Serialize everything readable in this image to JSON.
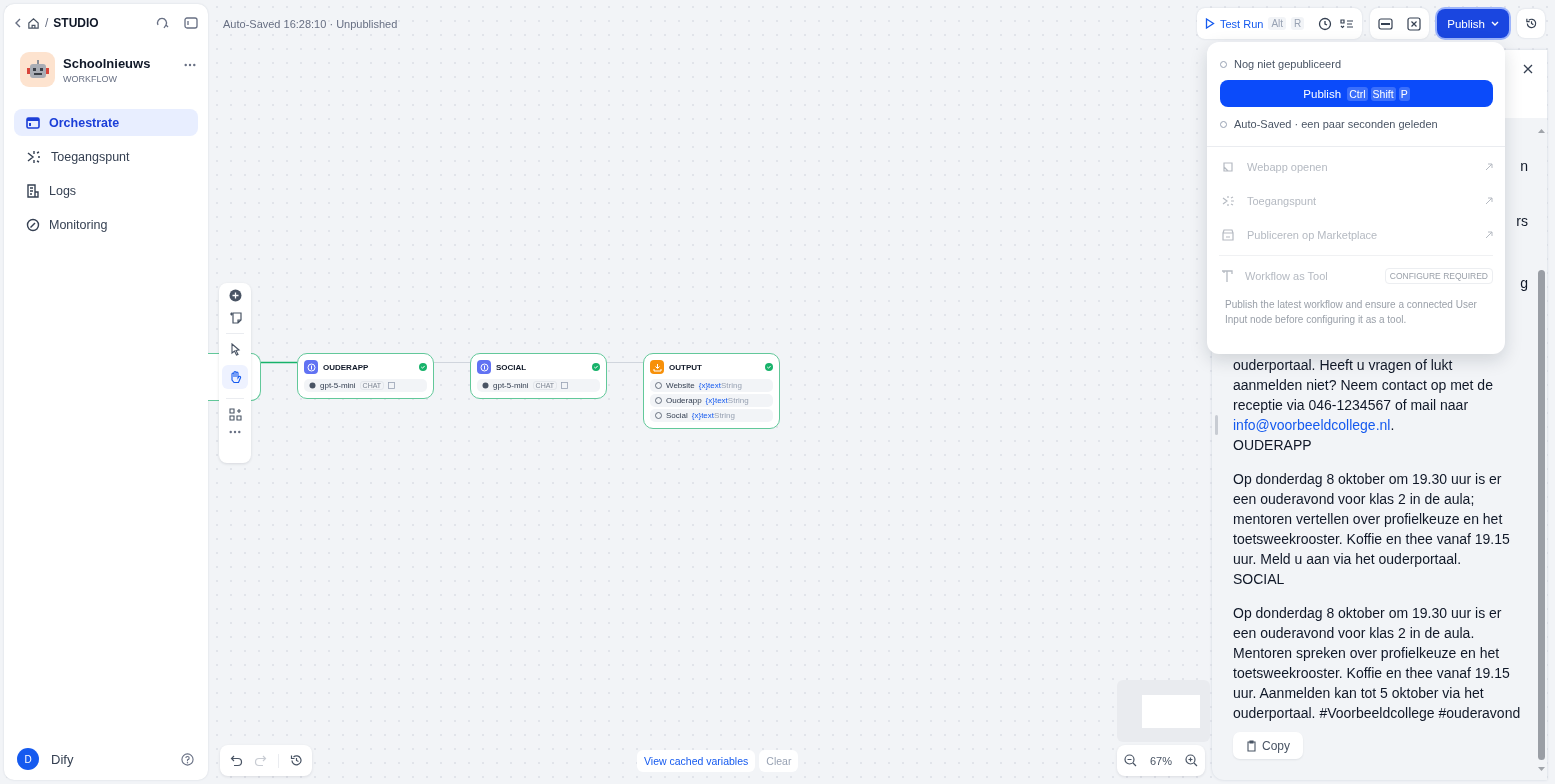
{
  "sidebar": {
    "separator": "/",
    "section": "STUDIO",
    "app": {
      "name": "Schoolnieuws",
      "type": "WORKFLOW"
    },
    "nav": [
      {
        "label": "Orchestrate",
        "selected": true
      },
      {
        "label": "Toegangspunt",
        "selected": false
      },
      {
        "label": "Logs",
        "selected": false
      },
      {
        "label": "Monitoring",
        "selected": false
      }
    ],
    "user": {
      "initial": "D",
      "name": "Dify"
    }
  },
  "header": {
    "status": "Auto-Saved 16:28:10 · Unpublished"
  },
  "toolbar": {
    "test_run": {
      "label": "Test Run",
      "keys": [
        "Alt",
        "R"
      ]
    },
    "publish": {
      "label": "Publish",
      "expanded": true
    }
  },
  "publish_menu": {
    "top_state": "Nog niet gepubliceerd",
    "publish_button": {
      "label": "Publish",
      "keys": [
        "Ctrl",
        "Shift",
        "P"
      ]
    },
    "bottom_state": "Auto-Saved · een paar seconden geleden",
    "actions": [
      {
        "label": "Webapp openen",
        "disabled": true
      },
      {
        "label": "Toegangspunt",
        "disabled": true
      },
      {
        "label": "Publiceren op Marketplace",
        "disabled": true
      }
    ],
    "tool": {
      "label": "Workflow as Tool",
      "badge": "CONFIGURE REQUIRED",
      "disabled": true
    },
    "hint": "Publish the latest workflow and ensure a connected User Input node before configuring it as a tool."
  },
  "canvas": {
    "nodes": [
      {
        "kind": "llm",
        "title": "OUDERAPP",
        "model": "gpt-5-mini",
        "mode": "CHAT"
      },
      {
        "kind": "llm",
        "title": "SOCIAL",
        "model": "gpt-5-mini",
        "mode": "CHAT"
      },
      {
        "kind": "output",
        "title": "OUTPUT",
        "outputs": [
          {
            "name": "Website",
            "var": "{x}text",
            "type": "String"
          },
          {
            "name": "Ouderapp",
            "var": "{x}text",
            "type": "String"
          },
          {
            "name": "Social",
            "var": "{x}text",
            "type": "String"
          }
        ]
      }
    ],
    "zoom": "67%"
  },
  "debug": {
    "view_cached": "View cached variables",
    "clear": "Clear"
  },
  "result_panel": {
    "fragments": [
      "n",
      "rs",
      "g"
    ],
    "blocks": [
      {
        "kind": "paragraph",
        "text": "ouderportaal. Heeft u vragen of lukt aanmelden niet? Neem contact op met de receptie via 046-1234567 of mail naar ",
        "link": "info@voorbeeldcollege.nl",
        "after": "."
      },
      {
        "kind": "heading",
        "text": "OUDERAPP"
      },
      {
        "kind": "paragraph",
        "text": "Op donderdag 8 oktober om 19.30 uur is er een ouderavond voor klas 2 in de aula; mentoren vertellen over profielkeuze en het toetsweekrooster. Koffie en thee vanaf 19.15 uur. Meld u aan via het ouderportaal."
      },
      {
        "kind": "heading",
        "text": "SOCIAL"
      },
      {
        "kind": "paragraph",
        "text": "Op donderdag 8 oktober om 19.30 uur is er een ouderavond voor klas 2 in de aula. Mentoren spreken over profielkeuze en het toetsweekrooster. Koffie en thee vanaf 19.15 uur. Aanmelden kan tot 5 oktober via het ouderportaal. #Voorbeeldcollege #ouderavond"
      }
    ],
    "copy": "Copy"
  }
}
